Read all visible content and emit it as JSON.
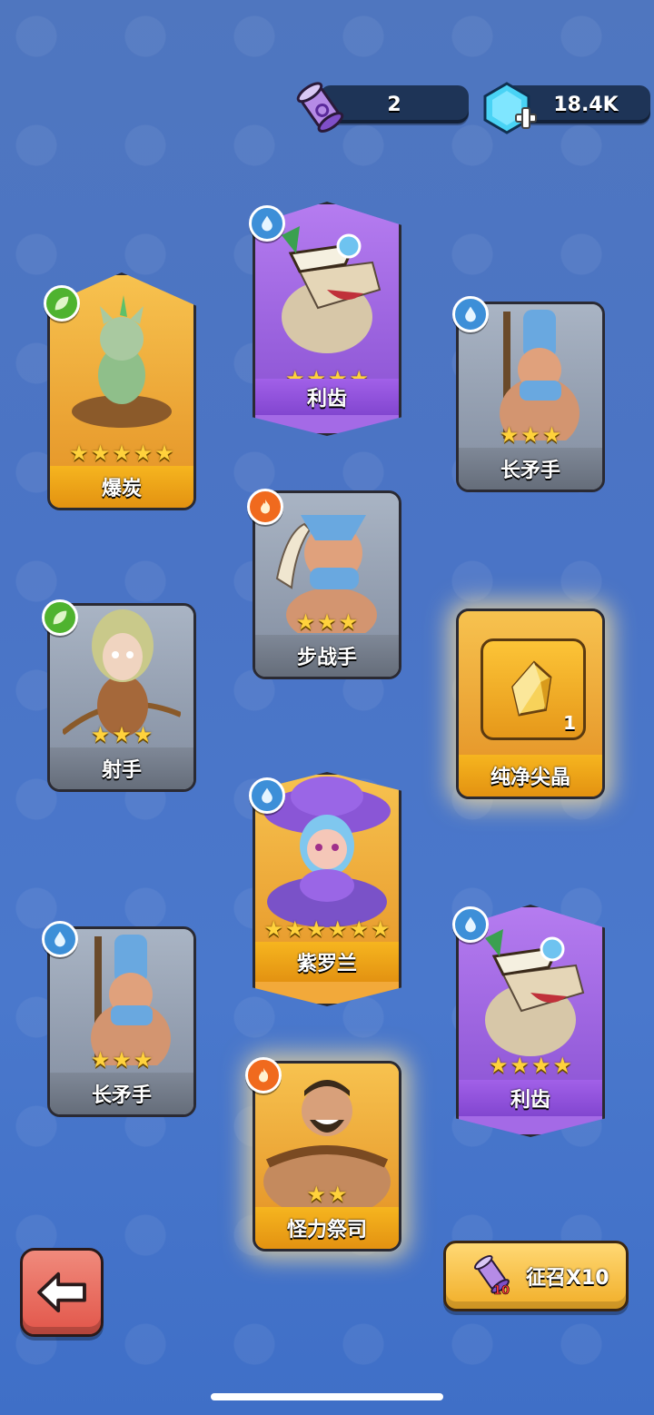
{
  "currency": {
    "scrolls": "2",
    "gems": "18.4K"
  },
  "cards": [
    {
      "name": "爆炭",
      "stars": 5,
      "rarity": "gold",
      "element": "leaf"
    },
    {
      "name": "利齿",
      "stars": 4,
      "rarity": "purple",
      "element": "water"
    },
    {
      "name": "长矛手",
      "stars": 3,
      "rarity": "grey",
      "element": "water"
    },
    {
      "name": "步战手",
      "stars": 3,
      "rarity": "grey",
      "element": "fire"
    },
    {
      "name": "射手",
      "stars": 3,
      "rarity": "grey",
      "element": "leaf"
    },
    {
      "name": "纯净尖晶",
      "count": "1",
      "rarity": "gold",
      "element": "item"
    },
    {
      "name": "紫罗兰",
      "stars": 6,
      "rarity": "gold",
      "element": "water"
    },
    {
      "name": "长矛手",
      "stars": 3,
      "rarity": "grey",
      "element": "water"
    },
    {
      "name": "利齿",
      "stars": 4,
      "rarity": "purple",
      "element": "water"
    },
    {
      "name": "怪力祭司",
      "stars": 2,
      "rarity": "gold",
      "element": "fire"
    }
  ],
  "buttons": {
    "summon_label": "征召X10",
    "summon_ticket_count": "10"
  },
  "colors": {
    "background": "#4a74c6",
    "gold": "#f2a93a",
    "purple": "#a46ae6",
    "grey": "#97a1b1",
    "star": "#ffd23c"
  }
}
